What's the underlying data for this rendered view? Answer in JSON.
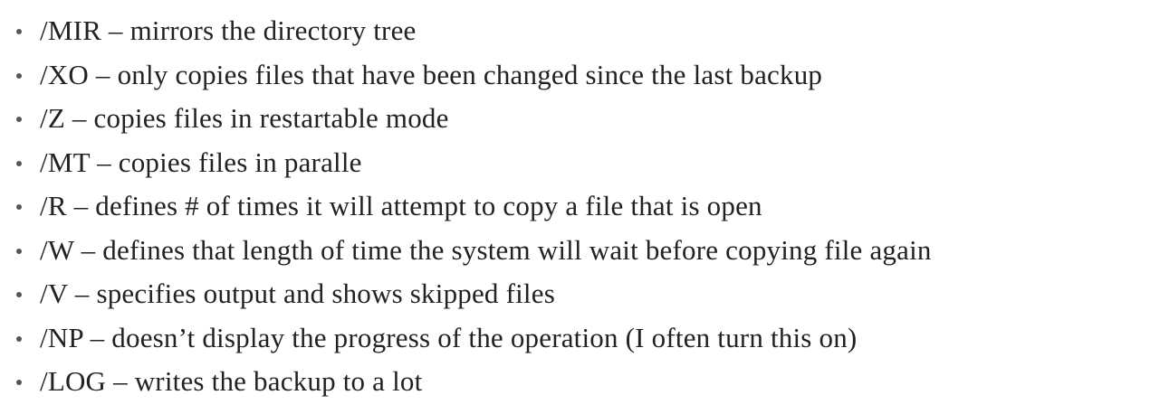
{
  "list": {
    "items": [
      {
        "text": "/MIR – mirrors the directory tree"
      },
      {
        "text": "/XO – only copies files that have been changed since the last backup"
      },
      {
        "text": "/Z – copies files in restartable mode"
      },
      {
        "text": "/MT – copies files in paralle"
      },
      {
        "text": "/R – defines # of times it will attempt to copy a file that is open"
      },
      {
        "text": "/W – defines that length of time the system will wait before copying file again"
      },
      {
        "text": "/V – specifies output and shows skipped files"
      },
      {
        "text": "/NP – doesn’t display the progress of the operation (I often turn this on)"
      },
      {
        "text": "/LOG – writes the backup to a lot"
      }
    ]
  },
  "colors": {
    "text": "#222222",
    "bullet": "#555555",
    "background": "#ffffff"
  }
}
